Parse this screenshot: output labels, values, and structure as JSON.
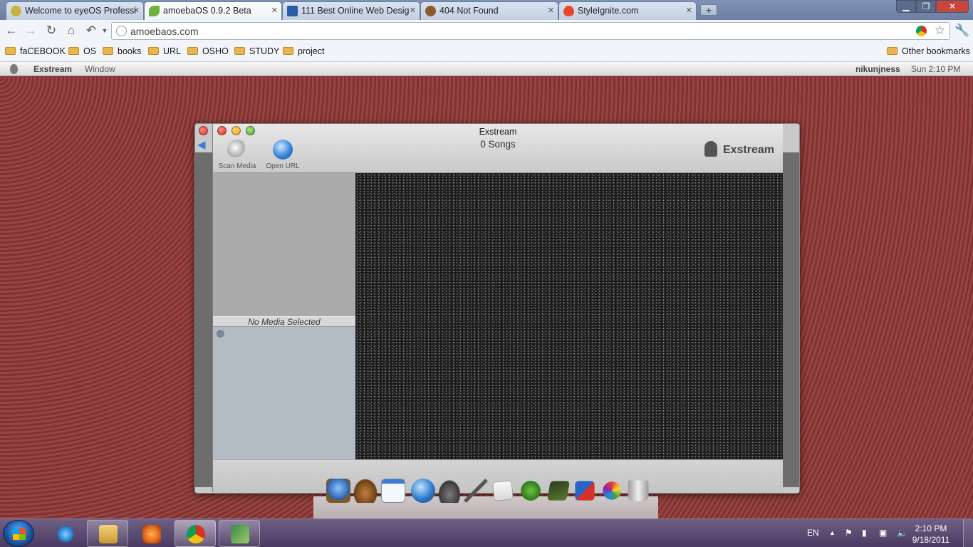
{
  "browser": {
    "tabs": [
      {
        "title": "Welcome to eyeOS Professi",
        "icon": "eyeos-icon",
        "favicon_color": "#c9b23c"
      },
      {
        "title": "amoebaOS 0.9.2 Beta",
        "icon": "amoeba-leaf-icon",
        "favicon_color": "#6db33f"
      },
      {
        "title": "111 Best Online Web Desig",
        "icon": "site-icon",
        "favicon_color": "#2a5ba8"
      },
      {
        "title": "404 Not Found",
        "icon": "monkey-icon",
        "favicon_color": "#8b5a2b"
      },
      {
        "title": "StyleIgnite.com",
        "icon": "flame-icon",
        "favicon_color": "#e8462a"
      }
    ],
    "url": "amoebaos.com",
    "bookmarks": [
      "faCEBOOK",
      "OS",
      "books",
      "URL",
      "OSHO",
      "STUDY",
      "project"
    ],
    "other_bookmarks": "Other bookmarks"
  },
  "os_menubar": {
    "app_name": "Exstream",
    "window_menu": "Window",
    "user": "nikunjness",
    "time": "Sun 2:10 PM"
  },
  "app_window": {
    "title": "Exstream",
    "song_count": "0 Songs",
    "tools": [
      {
        "label": "Scan Media",
        "icon": "magnifier-icon"
      },
      {
        "label": "Open URL",
        "icon": "globe-icon"
      }
    ],
    "brand": "Exstream",
    "media_status": "No Media Selected"
  },
  "dock": {
    "items": [
      "globe-download-icon",
      "coffee-cup-icon",
      "window-icon",
      "earth-icon",
      "padlock-icon",
      "pen-icon",
      "mail-icon",
      "bird-icon",
      "chart-icon",
      "pencils-icon",
      "color-wheel-icon",
      "trash-icon"
    ]
  },
  "taskbar": {
    "pinned": [
      "ie-icon",
      "explorer-folder-icon",
      "media-player-icon",
      "chrome-icon",
      "app-icon"
    ],
    "language": "EN",
    "clock_time": "2:10 PM",
    "clock_date": "9/18/2011"
  },
  "colors": {
    "desktop": "#8a3a38",
    "taskbar": "#5a4a72",
    "video_bg": "#1d1d1d"
  }
}
